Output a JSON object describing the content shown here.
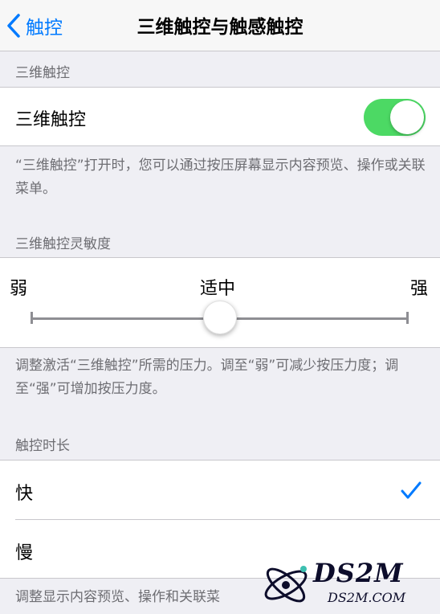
{
  "nav": {
    "back_label": "触控",
    "title": "三维触控与触感触控"
  },
  "section_3d": {
    "header": "三维触控",
    "row_label": "三维触控",
    "toggle_on": true,
    "footer": "“三维触控”打开时，您可以通过按压屏幕显示内容预览、操作或关联菜单。"
  },
  "section_sensitivity": {
    "header": "三维触控灵敏度",
    "label_weak": "弱",
    "label_medium": "适中",
    "label_strong": "强",
    "value_level": 0.5,
    "footer": "调整激活“三维触控”所需的压力。调至“弱”可减少按压力度；调至“强”可增加按压力度。"
  },
  "section_duration": {
    "header": "触控时长",
    "options": [
      {
        "label": "快",
        "selected": true
      },
      {
        "label": "慢",
        "selected": false
      }
    ],
    "footer": "调整显示内容预览、操作和关联菜"
  },
  "watermark": {
    "title": "DS2M",
    "url": "DS2M.COM"
  },
  "colors": {
    "accent": "#007aff",
    "toggle_on": "#4cd964",
    "background": "#efeff4",
    "secondary_text": "#6d6d72"
  }
}
